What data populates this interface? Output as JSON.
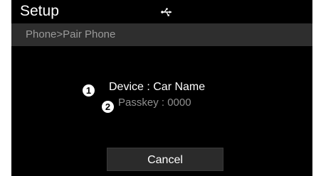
{
  "header": {
    "title": "Setup",
    "status_icon": "usb-icon"
  },
  "breadcrumb": {
    "text": "Phone>Pair Phone"
  },
  "pairing": {
    "device_callout": "1",
    "device_text": "Device : Car Name",
    "passkey_callout": "2",
    "passkey_text": "Passkey : 0000"
  },
  "actions": {
    "cancel_label": "Cancel"
  },
  "colors": {
    "background": "#000000",
    "breadcrumb_bar": "#2e2e2e",
    "primary_text": "#ffffff",
    "secondary_text": "#8f8f8f",
    "button_bg": "#2b2b2b"
  }
}
